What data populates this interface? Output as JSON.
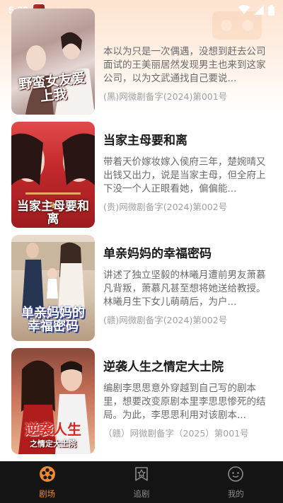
{
  "status_bar": {
    "time": "5:39"
  },
  "colors": {
    "accent": "#f08a2a",
    "tabbar_bg": "#141414",
    "title": "#1a1a1a",
    "desc": "#6a6a6a",
    "registration": "#a0a0a0"
  },
  "dramas": [
    {
      "title": "",
      "description": "本以为只是一次偶遇，没想到赶去公司面试的王美丽居然发现男主也来到这家公司，以为文武通找自己要说...",
      "registration": "(黑)网微剧备字(2024)第001号",
      "poster_text": "野蛮女友爱上我"
    },
    {
      "title": "当家主母要和离",
      "description": "带着天价嫁妆嫁入侯府三年，楚婉晴又出钱又出力，说是当家主母，但全府上下没一个人正眼看她，偏偏能...",
      "registration": "(贵)网微剧备字(2024)第002号",
      "poster_text": "当家主母要和离"
    },
    {
      "title": "单亲妈妈的幸福密码",
      "description": "讲述了独立坚毅的林曦月遭前男友萧慕凡背叛，萧慕凡甚至想将她送给教授。林曦月生下女儿萌萌后，为户...",
      "registration": "(赣)网微剧备字(2024)第002号",
      "poster_text": "单亲妈妈的幸福密码"
    },
    {
      "title": "逆袭人生之情定大士院",
      "description": "编剧李思思意外穿越到自己写的剧本里，想要改变原剧本里李思思惨死的结局。为此，李思思利用对该剧本...",
      "registration": "（赣）网微剧备字（2025）第001号",
      "poster_text": "逆袭人生",
      "poster_subtext": "之情定大士院"
    }
  ],
  "tabs": [
    {
      "label": "剧场",
      "icon": "film-reel-icon",
      "active": true
    },
    {
      "label": "追剧",
      "icon": "star-bookmark-icon",
      "active": false
    },
    {
      "label": "我的",
      "icon": "face-profile-icon",
      "active": false
    }
  ]
}
